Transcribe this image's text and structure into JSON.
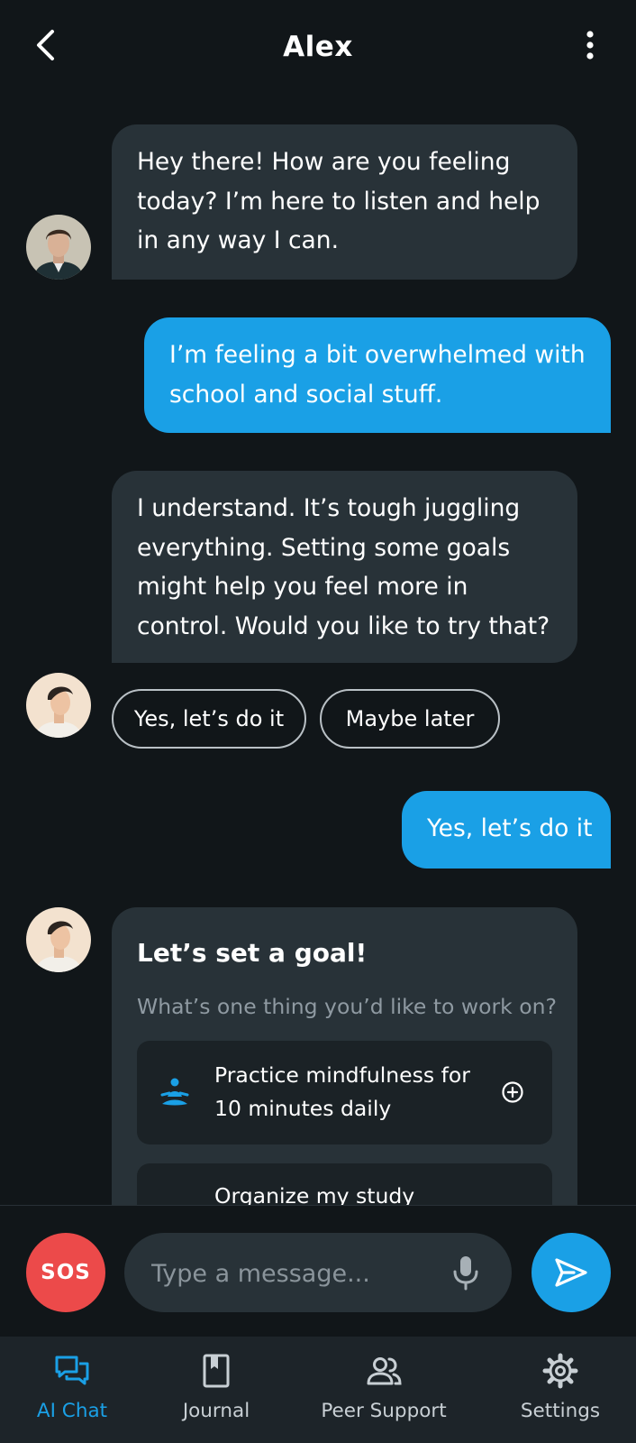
{
  "header": {
    "title": "Alex",
    "back_icon": "chevron-left-icon",
    "menu_icon": "more-vertical-icon"
  },
  "messages": [
    {
      "from": "bot",
      "lines": [
        "Hey there! How are you feeling",
        "today? I’m here to listen and help",
        "in any way I can."
      ]
    },
    {
      "from": "user",
      "lines": [
        "I’m feeling a bit overwhelmed with",
        "school and social stuff."
      ]
    },
    {
      "from": "bot",
      "lines": [
        "I understand. It’s tough juggling",
        "everything. Setting some goals",
        "might help you feel more in",
        "control. Would you like to try that?"
      ]
    },
    {
      "from": "user",
      "lines": [
        "Yes, let’s do it"
      ]
    }
  ],
  "quick_replies": [
    "Yes, let’s do it",
    "Maybe later"
  ],
  "goal_card": {
    "title": "Let’s set a goal!",
    "subtitle": "What’s one thing you’d like to work on?",
    "options": [
      {
        "lines": [
          "Practice mindfulness for",
          "10 minutes daily"
        ],
        "icon": "meditation-icon",
        "action_icon": "add-circle-icon"
      },
      {
        "lines": [
          "Organize my study"
        ],
        "icon": "",
        "action_icon": ""
      }
    ]
  },
  "composer": {
    "sos_label": "SOS",
    "placeholder": "Type a message...",
    "mic_icon": "microphone-icon",
    "send_icon": "send-icon"
  },
  "nav": {
    "items": [
      {
        "label": "AI Chat",
        "icon": "chat-icon",
        "active": true
      },
      {
        "label": "Journal",
        "icon": "journal-icon",
        "active": false
      },
      {
        "label": "Peer Support",
        "icon": "people-icon",
        "active": false
      },
      {
        "label": "Settings",
        "icon": "gear-icon",
        "active": false
      }
    ]
  },
  "colors": {
    "background": "#111619",
    "bot_bubble": "#283238",
    "user_bubble": "#1aa0e6",
    "sos": "#ec4a4a",
    "accent": "#1aa0e6"
  }
}
